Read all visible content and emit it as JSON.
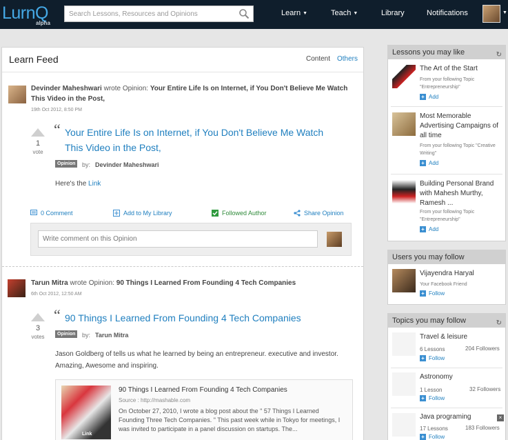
{
  "header": {
    "logo": "LurnQ",
    "logo_sub": "alpha",
    "search_placeholder": "Search Lessons, Resources and Opinions",
    "nav": [
      "Learn",
      "Teach",
      "Library",
      "Notifications"
    ]
  },
  "feed": {
    "title": "Learn Feed",
    "tabs": [
      "Content",
      "Others"
    ],
    "posts": [
      {
        "author": "Devinder Maheshwari",
        "verb": "wrote Opinion:",
        "head_title": "Your Entire Life Is on Internet, if You Don't Believe Me Watch This Video in the Post,",
        "date": "19th Oct 2012, 8:50 PM",
        "votes": "1",
        "votes_label": "vote",
        "title": "Your Entire Life Is on Internet, if You Don't Believe Me Watch This Video in the Post,",
        "tag": "Opinion",
        "by": "by:",
        "by_name": "Devinder Maheshwari",
        "body_prefix": "Here's the",
        "body_link": "Link",
        "actions": [
          "0 Comment",
          "Add to My Library",
          "Followed Author",
          "Share Opinion"
        ],
        "comment_placeholder": "Write comment on this Opinion"
      },
      {
        "author": "Tarun Mitra",
        "verb": "wrote Opinion:",
        "head_title": "90 Things I Learned From Founding 4 Tech Companies",
        "date": "6th Oct 2012, 12:50 AM",
        "votes": "3",
        "votes_label": "votes",
        "title": "90 Things I Learned From Founding 4 Tech Companies",
        "tag": "Opinion",
        "by": "by:",
        "by_name": "Tarun Mitra",
        "body": "Jason Goldberg of tells us what he learned by being an entrepreneur. executive and investor. Amazing, Awesome and inspiring.",
        "link_card": {
          "title": "90 Things I Learned From Founding 4 Tech Companies",
          "source": "Source : http://mashable.com",
          "desc": "On October 27, 2010, I wrote a blog post about the \" 57 Things I Learned Founding Three Tech Companies. \" This past week while in Tokyo for meetings, I was invited to participate in a panel discussion on startups. The...",
          "thumb_label": "Link"
        }
      }
    ]
  },
  "sidebar": {
    "lessons": {
      "title": "Lessons you may like",
      "items": [
        {
          "title": "The Art of the Start",
          "sub": "From your following Topic \"Entrepreneurship\"",
          "action": "Add"
        },
        {
          "title": "Most Memorable Advertising Campaigns of all time",
          "sub": "From your following Topic \"Creative Writing\"",
          "action": "Add"
        },
        {
          "title": "Building Personal Brand with Mahesh Murthy, Ramesh ...",
          "sub": "From your following Topic \"Entrepreneurship\"",
          "action": "Add"
        }
      ]
    },
    "users": {
      "title": "Users you may follow",
      "items": [
        {
          "name": "Vijayendra Haryal",
          "sub": "Your Facebook Friend",
          "action": "Follow"
        }
      ]
    },
    "topics": {
      "title": "Topics you may follow",
      "items": [
        {
          "name": "Travel & leisure",
          "lessons": "6 Lessons",
          "followers": "204 Followers",
          "action": "Follow"
        },
        {
          "name": "Astronomy",
          "lessons": "1 Lesson",
          "followers": "32 Followers",
          "action": "Follow"
        },
        {
          "name": "Java programing",
          "lessons": "17 Lessons",
          "followers": "183 Followers",
          "action": "Follow"
        }
      ]
    }
  }
}
